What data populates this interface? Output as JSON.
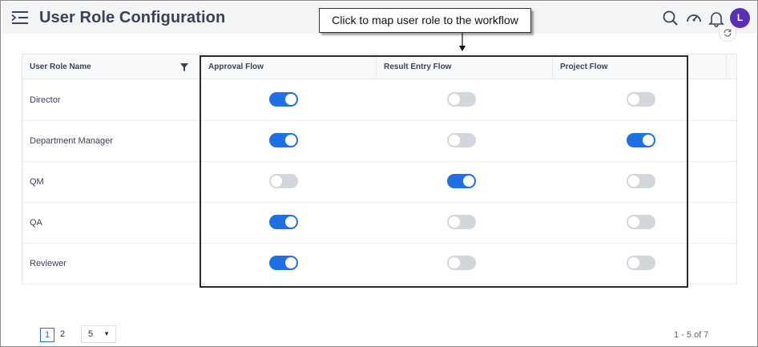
{
  "header": {
    "title": "User Role Configuration",
    "avatar_initial": "L",
    "icons": [
      "menu-collapse-icon",
      "search-icon",
      "dashboard-gauge-icon",
      "bell-icon"
    ],
    "accent_color": "#1f6fe5",
    "avatar_color": "#5b2fb5"
  },
  "callout": {
    "text": "Click to map user role to the workflow"
  },
  "grid": {
    "columns": [
      "User Role Name",
      "Approval Flow",
      "Result Entry Flow",
      "Project Flow"
    ],
    "rows": [
      {
        "name": "Director",
        "approval": true,
        "result_entry": false,
        "project": false
      },
      {
        "name": "Department Manager",
        "approval": true,
        "result_entry": false,
        "project": true
      },
      {
        "name": "QM",
        "approval": false,
        "result_entry": true,
        "project": false
      },
      {
        "name": "QA",
        "approval": true,
        "result_entry": false,
        "project": false
      },
      {
        "name": "Reviewer",
        "approval": true,
        "result_entry": false,
        "project": false
      }
    ]
  },
  "pagination": {
    "pages": [
      "1",
      "2"
    ],
    "current_page": "1",
    "page_size": "5",
    "info": "1 - 5 of 7"
  }
}
